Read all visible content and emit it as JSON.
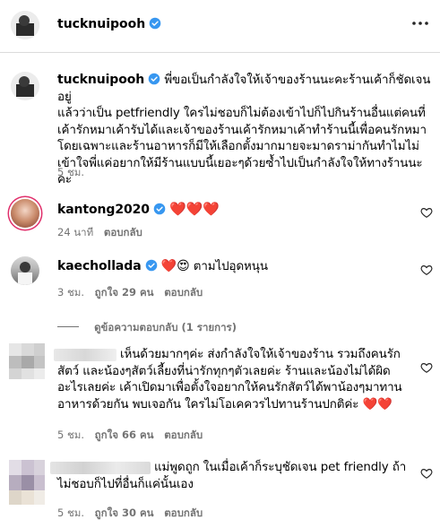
{
  "header": {
    "username": "tucknuipooh",
    "more_icon": "more-horizontal-icon"
  },
  "caption": {
    "username": "tucknuipooh",
    "lines": [
      "พี่ขอเป็นกำลังใจให้เจ้าของร้านนะคะร้านเค้าก็ชัดเจนอยู่",
      "แล้วว่าเป็น petfriendly ใครไม่ชอบก็ไม่ต้องเข้าไปก็ไปกินร้านอื่นแต่คนที่",
      "เค้ารักหมาเค้ารับได้และเจ้าของร้านเค้ารักหมาเค้าทำร้านนี้เพื่อคนรักหมา",
      "โดยเฉพาะและร้านอาหารก็มีให้เลือกตั้งมากมายจะมาดราม่ากันทำไมไม่",
      "เข้าใจพี่แค่อยากให้มีร้านแบบนี้เยอะๆด้วยซ้ำไปเป็นกำลังใจให้ทางร้านนะคะ"
    ],
    "time": "5 ชม."
  },
  "comments": [
    {
      "username": "kantong2020",
      "text": "❤️❤️❤️",
      "time": "24 นาที",
      "likes": "",
      "reply": "ตอบกลับ"
    },
    {
      "username": "kaechollada",
      "text": "ตามไปอุดหนุน",
      "emoji": "❤️😍",
      "time": "3 ชม.",
      "likes": "ถูกใจ 29 คน",
      "reply": "ตอบกลับ"
    }
  ],
  "view_replies": "ดูข้อความตอบกลับ (1 รายการ)",
  "blurred_comments": [
    {
      "lines": [
        "เห็นด้วยมากๆค่ะ ส่งกำลังใจให้เจ้าของร้าน รวมถึงคนรัก",
        "สัตว์ และน้องๆสัตว์เลี้ยงที่น่ารักทุกๆตัวเลยค่ะ ร้านและน้องไม่ได้ผิด",
        "อะไรเลยค่ะ เค้าเปิดมาเพื่อตั้งใจอยากให้คนรักสัตว์ได้พาน้องๆมาทาน",
        "อาหารด้วยกัน พบเจอกัน ใครไม่โอเคควรไปทานร้านปกติค่ะ ❤️❤️"
      ],
      "time": "5 ชม.",
      "likes": "ถูกใจ 66 คน",
      "reply": "ตอบกลับ"
    },
    {
      "lines": [
        "แม่พูดถูก ในเมื่อเค้าก็ระบุชัดเจน pet friendly ถ้า",
        "ไม่ชอบก็ไปที่อื่นก็แค่นั้นเอง"
      ],
      "time": "5 ชม.",
      "likes": "ถูกใจ 30 คน",
      "reply": "ตอบกลับ"
    }
  ],
  "colors": {
    "verified": "#3897f0",
    "meta": "#737373",
    "heart_red": "#ed1c3a"
  }
}
